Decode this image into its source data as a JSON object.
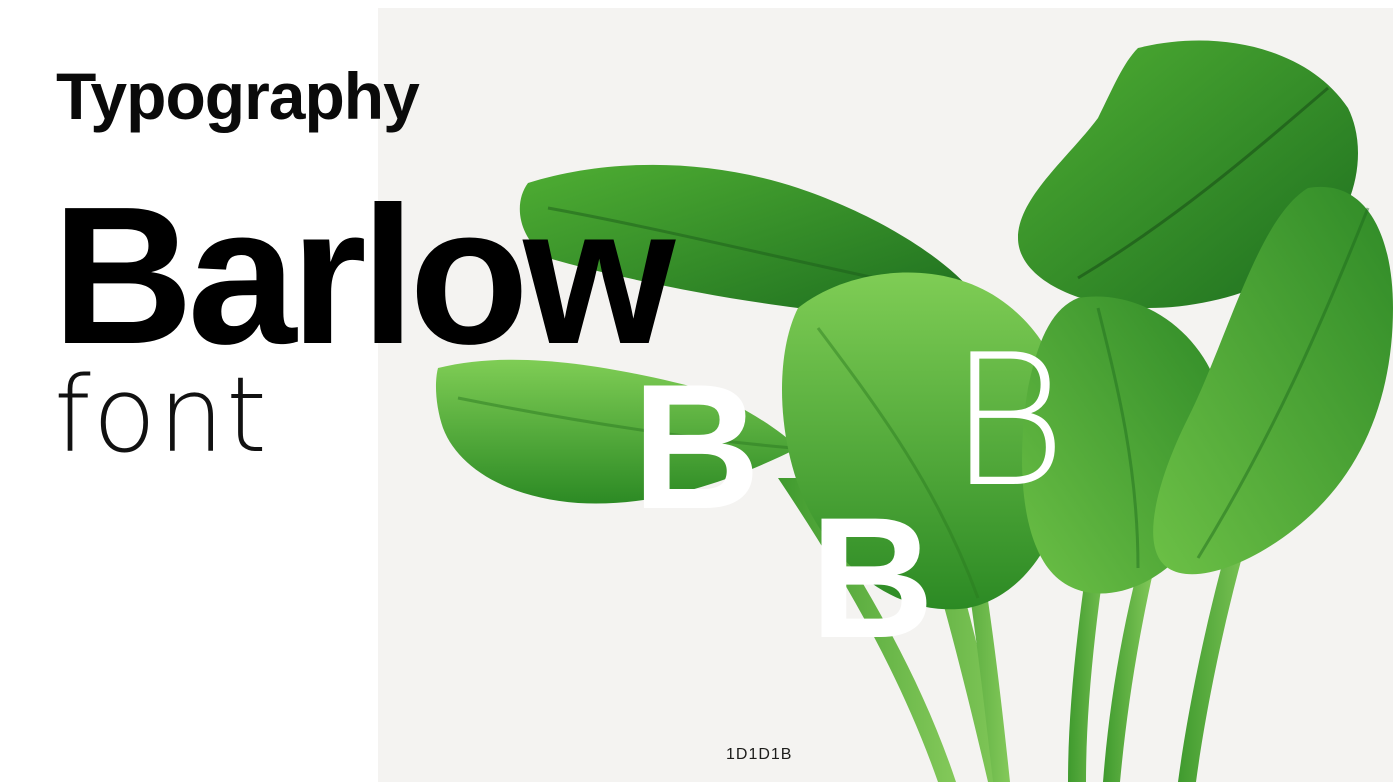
{
  "slide": {
    "heading": "Typography",
    "font_name": "Barlow",
    "font_sub": "font",
    "glyph_bold": "B",
    "glyph_light": "B",
    "glyph_heavy": "B",
    "color_code": "1D1D1B"
  },
  "colors": {
    "text": "#000000",
    "panel_background": "#f4f3f1",
    "glyph": "#ffffff",
    "leaf_dark": "#1f7a22",
    "leaf_mid": "#3a9a2c",
    "leaf_light": "#6cc046"
  }
}
